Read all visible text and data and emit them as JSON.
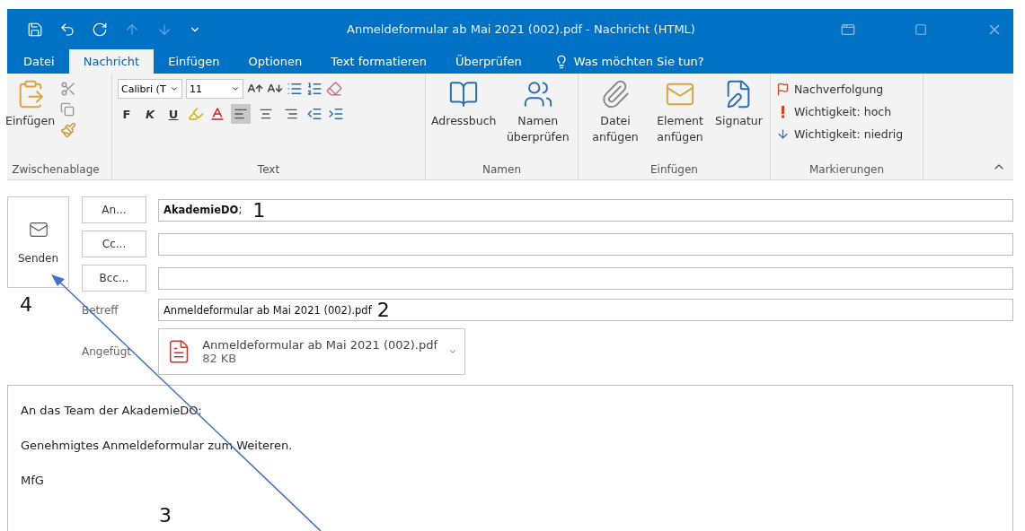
{
  "window": {
    "title": "Anmeldeformular ab Mai 2021 (002).pdf - Nachricht (HTML)"
  },
  "tabs": [
    {
      "label": "Datei",
      "selected": false
    },
    {
      "label": "Nachricht",
      "selected": true
    },
    {
      "label": "Einfügen",
      "selected": false
    },
    {
      "label": "Optionen",
      "selected": false
    },
    {
      "label": "Text formatieren",
      "selected": false
    },
    {
      "label": "Überprüfen",
      "selected": false
    }
  ],
  "tell_me": "Was möchten Sie tun?",
  "ribbon": {
    "clipboard": {
      "paste": "Einfügen",
      "group": "Zwischenablage"
    },
    "text": {
      "font": "Calibri (T",
      "size": "11",
      "bold": "F",
      "italic": "K",
      "underline": "U",
      "group": "Text",
      "align": [
        {
          "kind": "left",
          "selected": true
        },
        {
          "kind": "center",
          "selected": false
        },
        {
          "kind": "right",
          "selected": false
        }
      ]
    },
    "names": {
      "address_book": "Adressbuch",
      "check_names": "Namen überprüfen",
      "group": "Namen"
    },
    "insert": {
      "attach_file": "Datei anfügen",
      "attach_item": "Element anfügen",
      "signature": "Signatur",
      "group": "Einfügen"
    },
    "tags": {
      "follow_up": "Nachverfolgung",
      "high": "Wichtigkeit: hoch",
      "low": "Wichtigkeit: niedrig",
      "group": "Markierungen"
    }
  },
  "compose": {
    "send": "Senden",
    "recipients": [
      {
        "button": "An...",
        "value": "**AkademieDO**;"
      },
      {
        "button": "Cc..."
      },
      {
        "button": "Bcc..."
      }
    ],
    "subject_label": "Betreff",
    "subject": "Anmeldeformular ab Mai 2021 (002).pdf",
    "attached_label": "Angefügt",
    "attachment": {
      "name": "Anmeldeformular ab Mai 2021 (002).pdf",
      "size": "82 KB"
    },
    "body": [
      "An das Team der AkademieDO:",
      "Genehmigtes Anmeldeformular zum Weiteren.",
      "MfG"
    ]
  },
  "annotations": [
    "1",
    "2",
    "3",
    "4"
  ]
}
